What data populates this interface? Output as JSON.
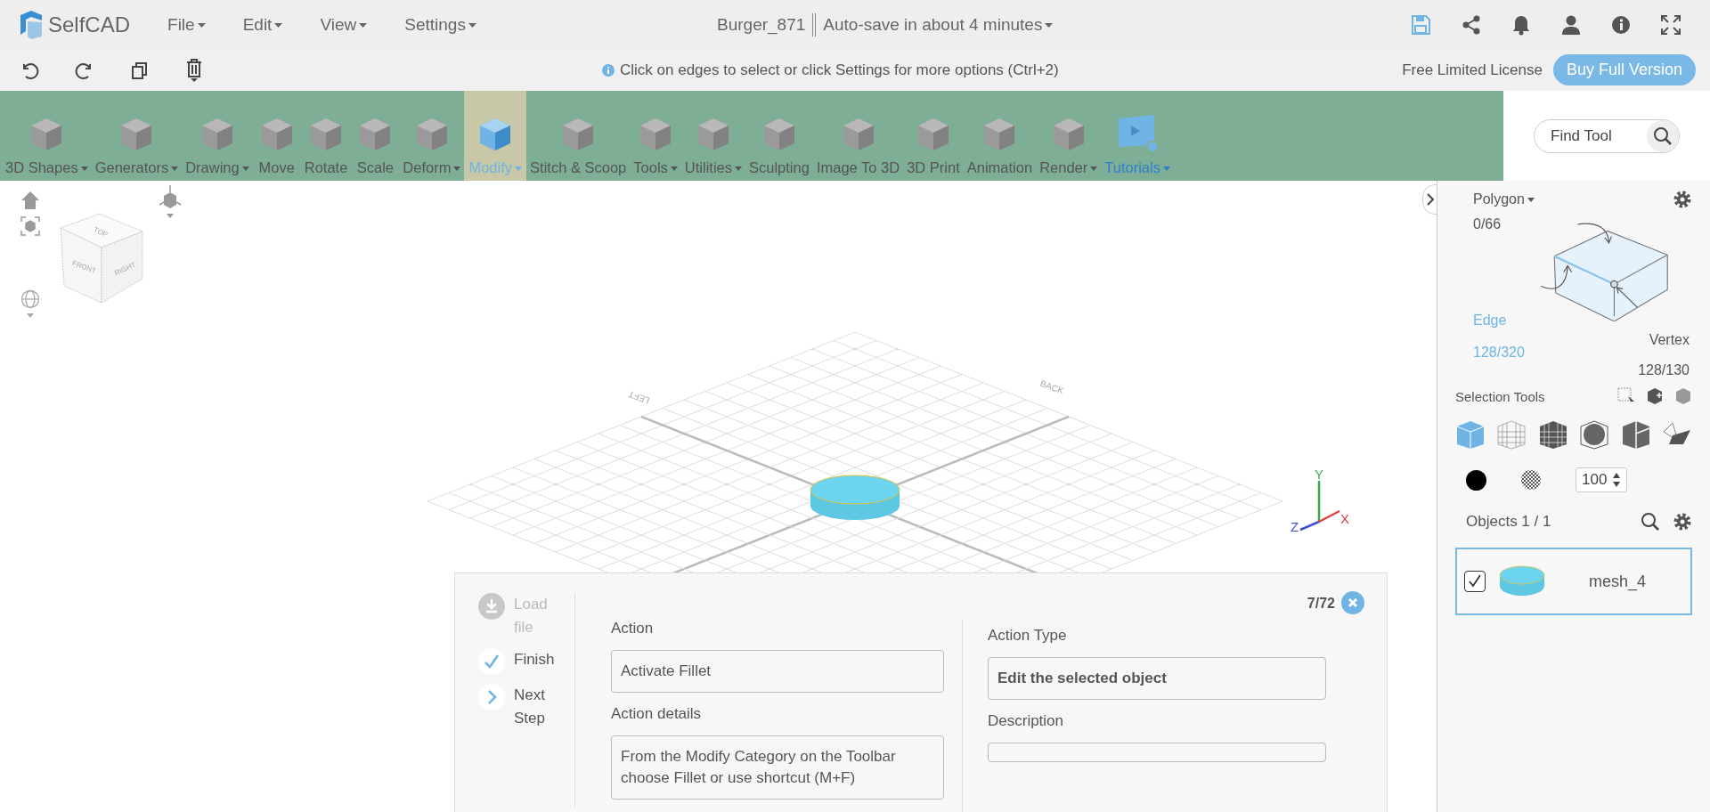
{
  "app": {
    "logo_text": "SelfCAD"
  },
  "menu": [
    {
      "label": "File"
    },
    {
      "label": "Edit"
    },
    {
      "label": "View"
    },
    {
      "label": "Settings"
    }
  ],
  "document": {
    "title": "Burger_871",
    "autosave": "Auto-save in about 4 minutes"
  },
  "hint": "Click on edges to select or click Settings for more options (Ctrl+2)",
  "license": "Free Limited License",
  "buy_button": "Buy Full Version",
  "toolbar": [
    {
      "label": "3D Shapes",
      "dropdown": true,
      "selected": false,
      "kind": "tool"
    },
    {
      "label": "Generators",
      "dropdown": true,
      "selected": false,
      "kind": "tool"
    },
    {
      "label": "Drawing",
      "dropdown": true,
      "selected": false,
      "kind": "tool"
    },
    {
      "label": "Move",
      "dropdown": false,
      "selected": false,
      "kind": "tool"
    },
    {
      "label": "Rotate",
      "dropdown": false,
      "selected": false,
      "kind": "tool"
    },
    {
      "label": "Scale",
      "dropdown": false,
      "selected": false,
      "kind": "tool"
    },
    {
      "label": "Deform",
      "dropdown": true,
      "selected": false,
      "kind": "tool"
    },
    {
      "label": "Modify",
      "dropdown": true,
      "selected": true,
      "kind": "tool"
    },
    {
      "label": "Stitch & Scoop",
      "dropdown": false,
      "selected": false,
      "kind": "tool"
    },
    {
      "label": "Tools",
      "dropdown": true,
      "selected": false,
      "kind": "tool"
    },
    {
      "label": "Utilities",
      "dropdown": true,
      "selected": false,
      "kind": "tool"
    },
    {
      "label": "Sculpting",
      "dropdown": false,
      "selected": false,
      "kind": "tool"
    },
    {
      "label": "Image To 3D",
      "dropdown": false,
      "selected": false,
      "kind": "tool"
    },
    {
      "label": "3D Print",
      "dropdown": false,
      "selected": false,
      "kind": "tool"
    },
    {
      "label": "Animation",
      "dropdown": false,
      "selected": false,
      "kind": "tool"
    },
    {
      "label": "Render",
      "dropdown": true,
      "selected": false,
      "kind": "tool"
    },
    {
      "label": "Tutorials",
      "dropdown": true,
      "selected": false,
      "kind": "tutorial"
    }
  ],
  "find_tool": {
    "placeholder": "Find Tool"
  },
  "viewport": {
    "cube_faces": [
      "TOP",
      "FRONT",
      "RIGHT"
    ],
    "grid_labels": [
      "LEFT",
      "BACK"
    ],
    "axes": [
      "Y",
      "Z",
      "X"
    ]
  },
  "selection": {
    "modes": [
      {
        "label": "Polygon",
        "count": "0/66",
        "dropdown": true,
        "selected": false
      },
      {
        "label": "Edge",
        "count": "128/320",
        "dropdown": false,
        "selected": true
      },
      {
        "label": "Vertex",
        "count": "128/130",
        "dropdown": false,
        "selected": false
      }
    ],
    "tools_label": "Selection Tools",
    "opacity": "100"
  },
  "objects": {
    "title": "Objects 1 / 1",
    "items": [
      {
        "name": "mesh_4",
        "checked": true,
        "selected": true
      }
    ]
  },
  "tutorial": {
    "counter": "7/72",
    "steps": [
      {
        "label": "Load file",
        "kind": "download",
        "disabled": true
      },
      {
        "label": "Finish",
        "kind": "finish",
        "disabled": false
      },
      {
        "label": "Next Step",
        "kind": "next",
        "disabled": false
      }
    ],
    "action_label": "Action",
    "action": "Activate Fillet",
    "details_label": "Action details",
    "details": "From the Modify Category on the Toolbar choose Fillet or use shortcut (M+F)",
    "type_label": "Action Type",
    "type": "Edit the selected object",
    "description_label": "Description"
  }
}
